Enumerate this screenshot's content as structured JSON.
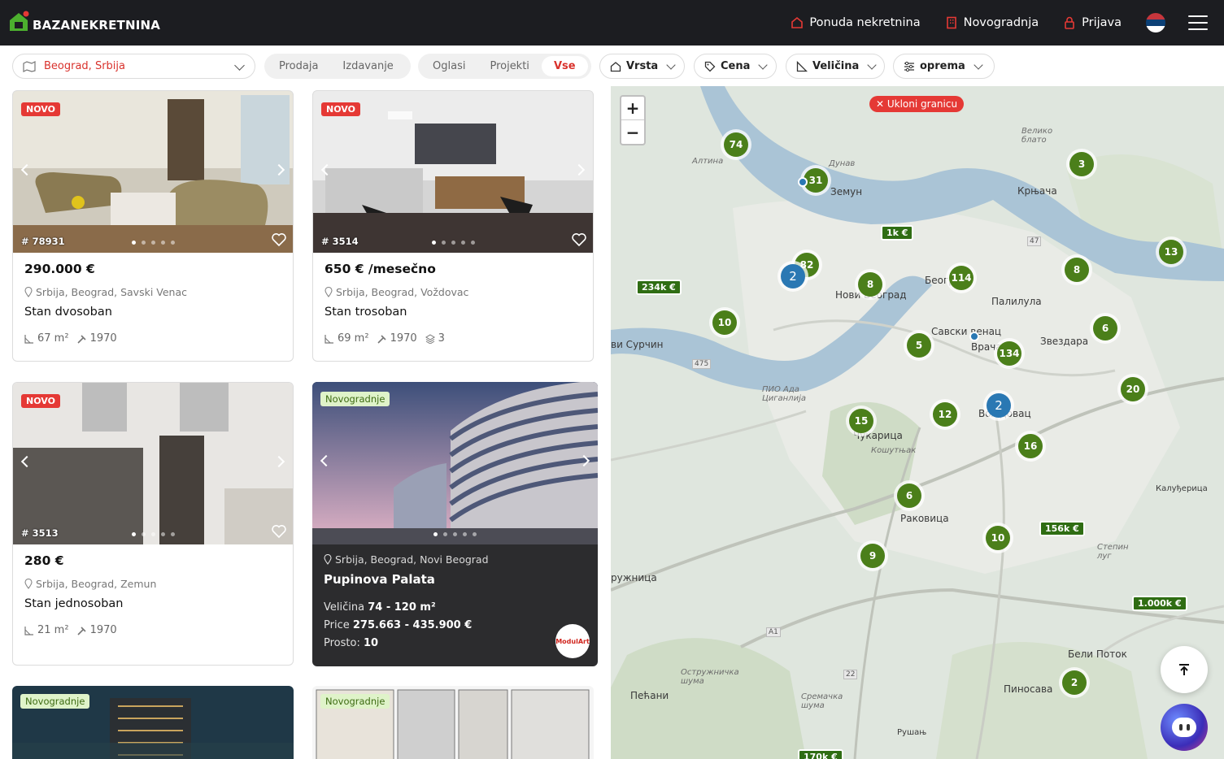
{
  "header": {
    "logo_text": "BAZANEKRETNINA",
    "nav": [
      {
        "label": "Ponuda nekretnina",
        "icon": "home-icon"
      },
      {
        "label": "Novogradnja",
        "icon": "building-icon"
      },
      {
        "label": "Prijava",
        "icon": "lock-icon"
      }
    ],
    "language_flag": "serbia-flag-icon",
    "menu_icon": "hamburger-icon"
  },
  "filters": {
    "location": "Beograd, Srbija",
    "deal_type": [
      "Prodaja",
      "Izdavanje"
    ],
    "listing_type": [
      "Oglasi",
      "Projekti",
      "Vse"
    ],
    "listing_type_selected": "Vse",
    "dropdowns": [
      {
        "label": "Vrsta",
        "icon": "home-icon"
      },
      {
        "label": "Cena",
        "icon": "tag-icon"
      },
      {
        "label": "Veličina",
        "icon": "ruler-icon"
      },
      {
        "label": "oprema",
        "icon": "sliders-icon"
      }
    ]
  },
  "listings": [
    {
      "badge": "NOVO",
      "id": "# 78931",
      "price": "290.000 €",
      "address": "Srbija, Beograd, Savski Venac",
      "title": "Stan dvosoban",
      "area": "67 m²",
      "year": "1970",
      "floor": ""
    },
    {
      "badge": "NOVO",
      "id": "# 3514",
      "price": "650 € /mesečno",
      "address": "Srbija, Beograd, Voždovac",
      "title": "Stan trosoban",
      "area": "69 m²",
      "year": "1970",
      "floor": "3"
    },
    {
      "badge": "NOVO",
      "id": "# 3513",
      "price": "280 €",
      "address": "Srbija, Beograd, Zemun",
      "title": "Stan jednosoban",
      "area": "21 m²",
      "year": "1970",
      "floor": ""
    }
  ],
  "project": {
    "badge": "Novogradnje",
    "address": "Srbija, Beograd, Novi Beograd",
    "title": "Pupinova Palata",
    "size_label": "Veličina",
    "size_value": "74 - 120 m²",
    "price_label": "Price",
    "price_value": "275.663 - 435.900 €",
    "rooms_label": "Prosto:",
    "rooms_value": "10",
    "developer_logo": "ModulArt"
  },
  "more_projects": [
    {
      "badge": "Novogradnje"
    },
    {
      "badge": "Novogradnje"
    }
  ],
  "map": {
    "zoom_in": "+",
    "zoom_out": "−",
    "remove_boundary": "✕ Ukloni granicu",
    "clusters": [
      "74",
      "31",
      "82",
      "2",
      "8",
      "114",
      "10",
      "5",
      "134",
      "2",
      "15",
      "12",
      "16",
      "6",
      "10",
      "9",
      "3",
      "8",
      "13",
      "6",
      "20",
      "2"
    ],
    "price_tags": [
      "1k €",
      "234k €",
      "156k €",
      "1.000k €",
      "170k €"
    ],
    "places": [
      "Земун",
      "Београд",
      "Нови Београд",
      "Палилула",
      "Савски венац",
      "Врачар",
      "Звездара",
      "Вождовац",
      "Чукарица",
      "Раковица",
      "Крњача",
      "Бели Поток",
      "Пиносава",
      "Пећани",
      "Рушањ",
      "Калуђерица",
      "ви Сурчин",
      "ружница",
      "Велико блато",
      "Алтина",
      "Дунав",
      "ПИО Ада Циганлија",
      "Кошутњак",
      "Степин луг",
      "Сремачка шума",
      "Остружничка шума"
    ],
    "roads": [
      "47",
      "475",
      "A1",
      "22"
    ]
  },
  "buttons": {
    "scroll_top_icon": "arrow-up-icon",
    "chat_icon": "chatbot-icon"
  }
}
